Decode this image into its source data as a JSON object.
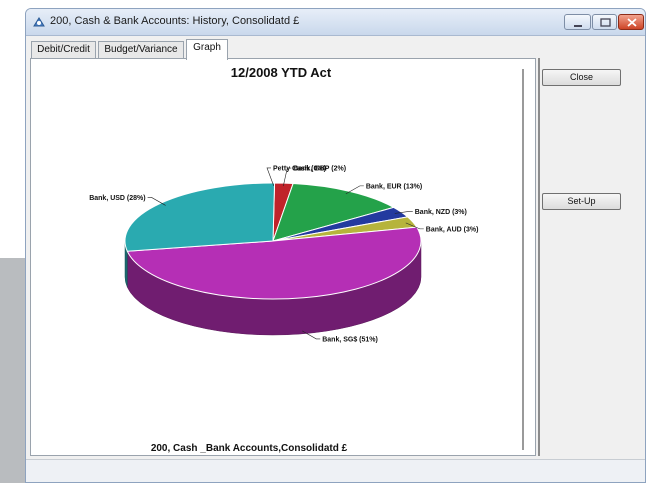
{
  "window": {
    "title": "200, Cash & Bank Accounts: History, Consolidatd £"
  },
  "tabs": [
    {
      "label": "Debit/Credit"
    },
    {
      "label": "Budget/Variance"
    },
    {
      "label": "Graph"
    }
  ],
  "buttons": {
    "close": "Close",
    "setup": "Set-Up"
  },
  "chart_data": {
    "type": "pie",
    "title": "12/2008 YTD Act",
    "subtitle": "200, Cash _Bank Accounts,Consolidatd £",
    "three_d": true,
    "slices": [
      {
        "label": "Petty Cash (0%)",
        "value": 0,
        "color": "#1d5fbf"
      },
      {
        "label": "Bank, GBP (2%)",
        "value": 2,
        "color": "#c0232a"
      },
      {
        "label": "Bank, EUR (13%)",
        "value": 13,
        "color": "#24a24a"
      },
      {
        "label": "Bank, NZD (3%)",
        "value": 3,
        "color": "#233a9f"
      },
      {
        "label": "Bank, AUD (3%)",
        "value": 3,
        "color": "#b6b43c"
      },
      {
        "label": "Bank, SG$ (51%)",
        "value": 51,
        "color": "#b52fb5"
      },
      {
        "label": "Bank, USD (28%)",
        "value": 28,
        "color": "#2aaab0"
      }
    ]
  }
}
